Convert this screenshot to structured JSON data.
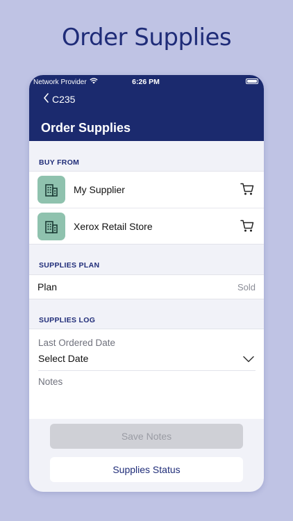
{
  "promo": {
    "title": "Order Supplies"
  },
  "status_bar": {
    "carrier": "Network Provider",
    "time": "6:26 PM"
  },
  "nav": {
    "back_label": "C235",
    "title": "Order Supplies"
  },
  "buy_from": {
    "section_label": "BUY FROM",
    "suppliers": [
      {
        "name": "My Supplier",
        "icon": "building-icon",
        "action_icon": "cart-icon"
      },
      {
        "name": "Xerox Retail Store",
        "icon": "building-icon",
        "action_icon": "cart-icon"
      }
    ]
  },
  "supplies_plan": {
    "section_label": "SUPPLIES PLAN",
    "label": "Plan",
    "value": "Sold"
  },
  "supplies_log": {
    "section_label": "SUPPLIES LOG",
    "last_ordered_label": "Last Ordered Date",
    "date_value": "Select Date",
    "notes_placeholder": "Notes"
  },
  "actions": {
    "save_label": "Save Notes",
    "status_label": "Supplies Status"
  },
  "colors": {
    "background": "#bfc3e4",
    "header": "#1b2a6e",
    "accent_text": "#1f2c78",
    "supplier_icon_bg": "#8fc2ae"
  }
}
